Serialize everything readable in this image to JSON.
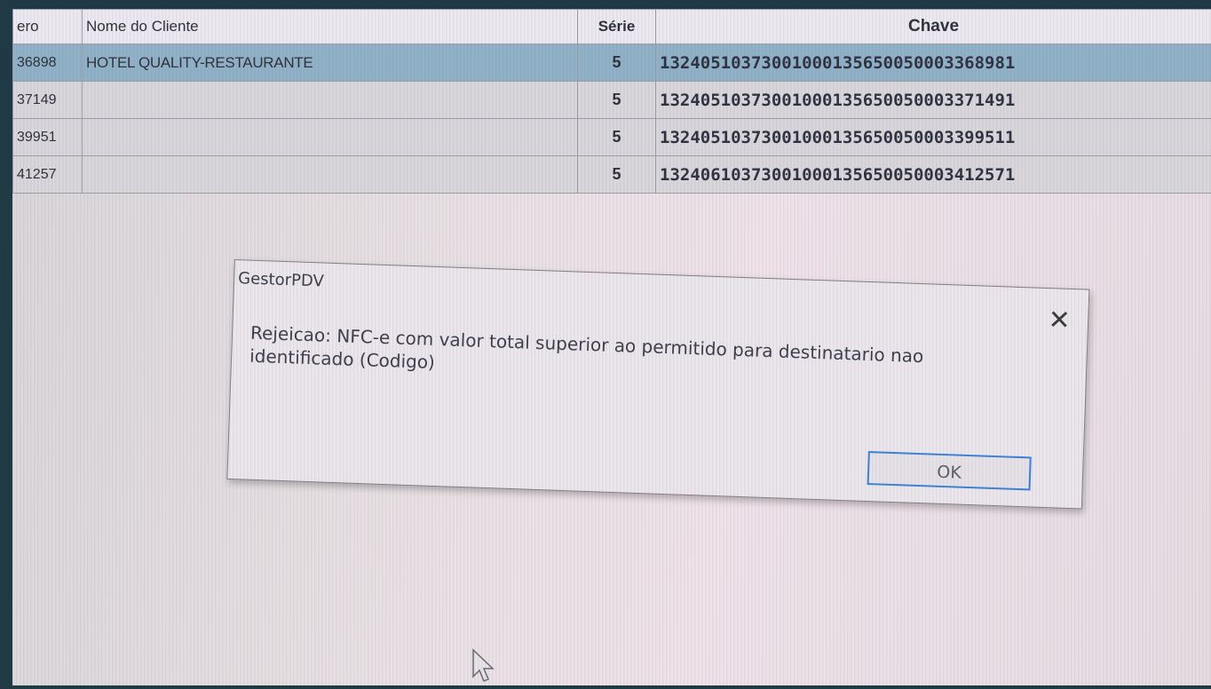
{
  "grid": {
    "columns": [
      "ero",
      "Nome do Cliente",
      "Série",
      "Chave"
    ],
    "rows": [
      {
        "numero": "36898",
        "cliente": "HOTEL QUALITY-RESTAURANTE",
        "serie": "5",
        "chave": "13240510373001000135650050003368981"
      },
      {
        "numero": "37149",
        "cliente": "",
        "serie": "5",
        "chave": "13240510373001000135650050003371491"
      },
      {
        "numero": "39951",
        "cliente": "",
        "serie": "5",
        "chave": "13240510373001000135650050003399511"
      },
      {
        "numero": "41257",
        "cliente": "",
        "serie": "5",
        "chave": "13240610373001000135650050003412571"
      }
    ]
  },
  "dialog": {
    "title": "GestorPDV",
    "close_icon": "close-icon",
    "message": "Rejeicao: NFC-e com valor total superior ao permitido para destinatario nao identificado (Codigo)",
    "ok_label": "OK"
  }
}
